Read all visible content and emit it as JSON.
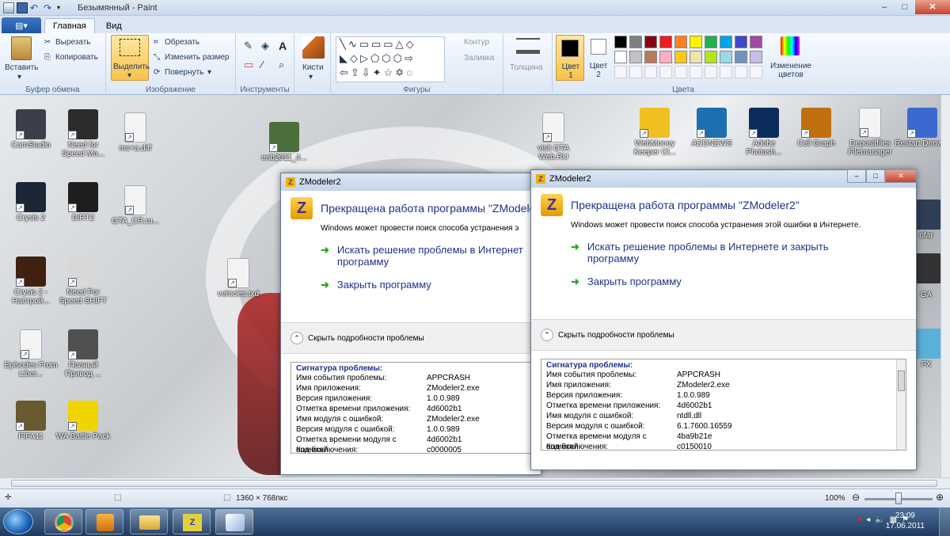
{
  "window": {
    "title": "Безымянный - Paint"
  },
  "tabs": [
    {
      "label": "Главная"
    },
    {
      "label": "Вид"
    }
  ],
  "ribbon": {
    "clipboard": {
      "paste": "Вставить",
      "cut": "Вырезать",
      "copy": "Копировать",
      "group": "Буфер обмена"
    },
    "image": {
      "select": "Выделить",
      "crop": "Обрезать",
      "resize": "Изменить размер",
      "rotate": "Повернуть",
      "group": "Изображение"
    },
    "tools": {
      "group": "Инструменты"
    },
    "brushes": {
      "label": "Кисти"
    },
    "shapes": {
      "contour": "Контур",
      "fill": "Заливка",
      "group": "Фигуры"
    },
    "size": {
      "label": "Толщина"
    },
    "colors": {
      "color1": "Цвет 1",
      "color2": "Цвет 2",
      "edit": "Изменение цветов",
      "group": "Цвета"
    },
    "palette": [
      "#000000",
      "#7f7f7f",
      "#880015",
      "#ed1c24",
      "#ff7f27",
      "#fff200",
      "#22b14c",
      "#00a2e8",
      "#3f48cc",
      "#a349a4",
      "#ffffff",
      "#c3c3c3",
      "#b97a57",
      "#ffaec9",
      "#ffc90e",
      "#efe4b0",
      "#b5e61d",
      "#99d9ea",
      "#7092be",
      "#c8bfe7"
    ]
  },
  "desktop": {
    "icons": [
      {
        "label": "CamStudio",
        "color": "#3a3f4a"
      },
      {
        "label": "Need for Speed Mo...",
        "color": "#2c2c2c"
      },
      {
        "label": "mc+a.diff",
        "color": "#f4f4f4"
      },
      {
        "label": "Crysis 2",
        "color": "#1b2636"
      },
      {
        "label": "DiRT2",
        "color": "#1e1e1e"
      },
      {
        "label": "GTA_CR.ru...",
        "color": "#f4f4f4"
      },
      {
        "label": "Crysis 2 - Настрой...",
        "color": "#402010"
      },
      {
        "label": "Need For Speed SHIFT",
        "color": "#d8d8d8"
      },
      {
        "label": "vehicles.txd",
        "color": "#f4f4f4"
      },
      {
        "label": "Episodes From Liber...",
        "color": "#f4f4f4"
      },
      {
        "label": "Полный Привод ...",
        "color": "#505050"
      },
      {
        "label": "FIFA11",
        "color": "#6a5a30"
      },
      {
        "label": "WA Battle Pack",
        "color": "#f0d400"
      },
      {
        "label": "enb2011_4...",
        "color": "#4b6e3a"
      },
      {
        "label": "visit GTA Web.RU",
        "color": "#f4f4f4"
      },
      {
        "label": "WebMoney Keeper Cl...",
        "color": "#f0c020"
      },
      {
        "label": "ADDNEWS",
        "color": "#1d6fb0"
      },
      {
        "label": "Adobe Photosh...",
        "color": "#0c2d5c"
      },
      {
        "label": "Cell Graph",
        "color": "#c07010"
      },
      {
        "label": "Depositfiles Filemanager",
        "color": "#f4f4f4"
      },
      {
        "label": "Restart Denwer",
        "color": "#3a6ad0"
      }
    ],
    "partial_labels": {
      "ofar": "ofar",
      "s": "s",
      "ga": "GA",
      "fx": "FX"
    }
  },
  "dialog1": {
    "title": "ZModeler2",
    "heading": "Прекращена работа программы \"ZModeler2\"",
    "sub": "Windows может провести поиск способа устранения э",
    "link1a": "Искать решение проблемы в Интернет",
    "link1b": "программу",
    "link2": "Закрыть программу",
    "details": "Скрыть подробности проблемы",
    "sig_title": "Сигнатура проблемы:",
    "rows": [
      {
        "k": "Имя события проблемы:",
        "v": "APPCRASH"
      },
      {
        "k": "Имя приложения:",
        "v": "ZModeler2.exe"
      },
      {
        "k": "Версия приложения:",
        "v": "1.0.0.989"
      },
      {
        "k": "Отметка времени приложения:",
        "v": "4d6002b1"
      },
      {
        "k": "Имя модуля с ошибкой:",
        "v": "ZModeler2.exe"
      },
      {
        "k": "Версия модуля с ошибкой:",
        "v": "1.0.0.989"
      },
      {
        "k": "Отметка времени модуля с ошибкой:",
        "v": "4d6002b1"
      },
      {
        "k": "Код исключения:",
        "v": "c0000005"
      }
    ]
  },
  "dialog2": {
    "title": "ZModeler2",
    "heading": "Прекращена работа программы \"ZModeler2\"",
    "sub": "Windows может провести поиск способа устранения этой ошибки в Интернете.",
    "link1a": "Искать решение проблемы в Интернете и закрыть",
    "link1b": "программу",
    "link2": "Закрыть программу",
    "details": "Скрыть подробности проблемы",
    "sig_title": "Сигнатура проблемы:",
    "rows": [
      {
        "k": "Имя события проблемы:",
        "v": "APPCRASH"
      },
      {
        "k": "Имя приложения:",
        "v": "ZModeler2.exe"
      },
      {
        "k": "Версия приложения:",
        "v": "1.0.0.989"
      },
      {
        "k": "Отметка времени приложения:",
        "v": "4d6002b1"
      },
      {
        "k": "Имя модуля с ошибкой:",
        "v": "ntdll.dll"
      },
      {
        "k": "Версия модуля с ошибкой:",
        "v": "6.1.7600.16559"
      },
      {
        "k": "Отметка времени модуля с ошибкой:",
        "v": "4ba9b21e"
      },
      {
        "k": "Код исключения:",
        "v": "c0150010"
      }
    ]
  },
  "statusbar": {
    "dimensions": "1360 × 768пкс",
    "zoom": "100%"
  },
  "taskbar": {
    "time": "23:09",
    "date": "17.06.2011"
  }
}
